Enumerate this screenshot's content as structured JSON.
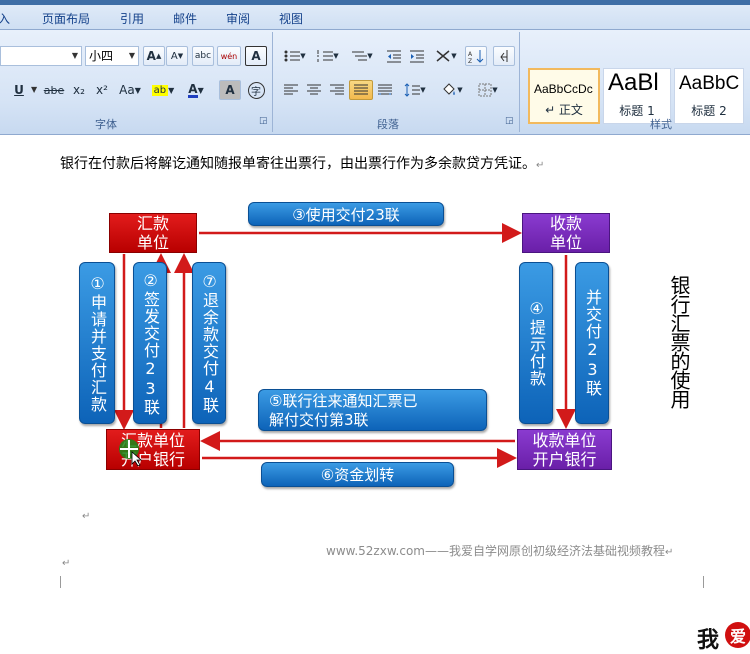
{
  "tabs": [
    "插入",
    "页面布局",
    "引用",
    "邮件",
    "审阅",
    "视图"
  ],
  "font_group": {
    "label": "字体",
    "font_name": "",
    "font_size": "小四",
    "buttons": [
      "A",
      "A",
      "abc",
      "wén",
      "A",
      "U",
      "abe",
      "x₂",
      "x²",
      "Aa",
      "A",
      "A",
      "字"
    ]
  },
  "paragraph_group": {
    "label": "段落"
  },
  "styles_group": {
    "label": "样式",
    "styles": [
      {
        "sample": "AaBbCcDc",
        "name": "↵ 正文"
      },
      {
        "sample": "AaBl",
        "name": "标题 1"
      },
      {
        "sample": "AaBbC",
        "name": "标题 2"
      }
    ]
  },
  "document": {
    "body_text": "银行在付款后将解讫通知随报单寄往出票行，由出票行作为多余款贷方凭证。",
    "para_mark": "↵",
    "side_title": "银行汇票的使用",
    "footer": "www.52zxw.com——我爱自学网原创初级经济法基础视频教程",
    "logo_text": "我爱"
  },
  "diagram": {
    "remitter": "汇款\n单位",
    "payee": "收款\n单位",
    "remitter_bank": "汇款单位\n开户银行",
    "payee_bank": "收款单位\n开户银行",
    "step1": "①申请并支付汇款",
    "step2": "②签发交付23联",
    "step3": "③使用交付23联",
    "step4": "④提示付款",
    "step4b": "并交付23联",
    "step5": "⑤联行往来通知汇票已\n解付交付第3联",
    "step6": "⑥资金划转",
    "step7": "⑦退余款交付4联",
    "colors": {
      "red": "#cc0a0a",
      "purple": "#7a2cbc",
      "blue": "#1a78d0",
      "arrow": "#d21a1a"
    }
  }
}
